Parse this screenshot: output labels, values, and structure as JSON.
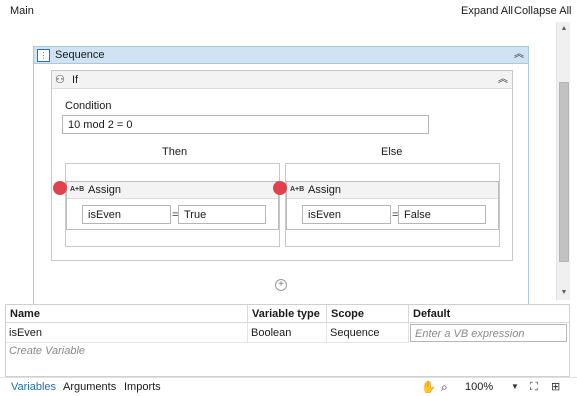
{
  "topbar": {
    "title": "Main",
    "expand_all": "Expand All",
    "collapse_all": "Collapse All"
  },
  "sequence": {
    "label": "Sequence"
  },
  "if": {
    "label": "If",
    "condition_label": "Condition",
    "condition_value": "10 mod 2 = 0",
    "then_label": "Then",
    "else_label": "Else",
    "then_assign": {
      "label": "Assign",
      "icon_text": "A+B",
      "to": "isEven",
      "value": "True"
    },
    "else_assign": {
      "label": "Assign",
      "icon_text": "A+B",
      "to": "isEven",
      "value": "False"
    }
  },
  "variables": {
    "columns": [
      "Name",
      "Variable type",
      "Scope",
      "Default"
    ],
    "rows": [
      {
        "name": "isEven",
        "type": "Boolean",
        "scope": "Sequence",
        "default_placeholder": "Enter a VB expression"
      }
    ],
    "create_label": "Create Variable"
  },
  "bottombar": {
    "tabs": [
      "Variables",
      "Arguments",
      "Imports"
    ],
    "active_tab": "Variables",
    "zoom": "100%"
  },
  "colors": {
    "accent": "#1f6fb5",
    "breakpoint": "#e0434d",
    "sequence_header": "#cfe3f4"
  },
  "icons": [
    "sequence-icon",
    "if-icon",
    "assign-icon",
    "add-icon",
    "collapse-icon",
    "hand-icon",
    "search-icon",
    "fit-icon",
    "overview-icon"
  ]
}
